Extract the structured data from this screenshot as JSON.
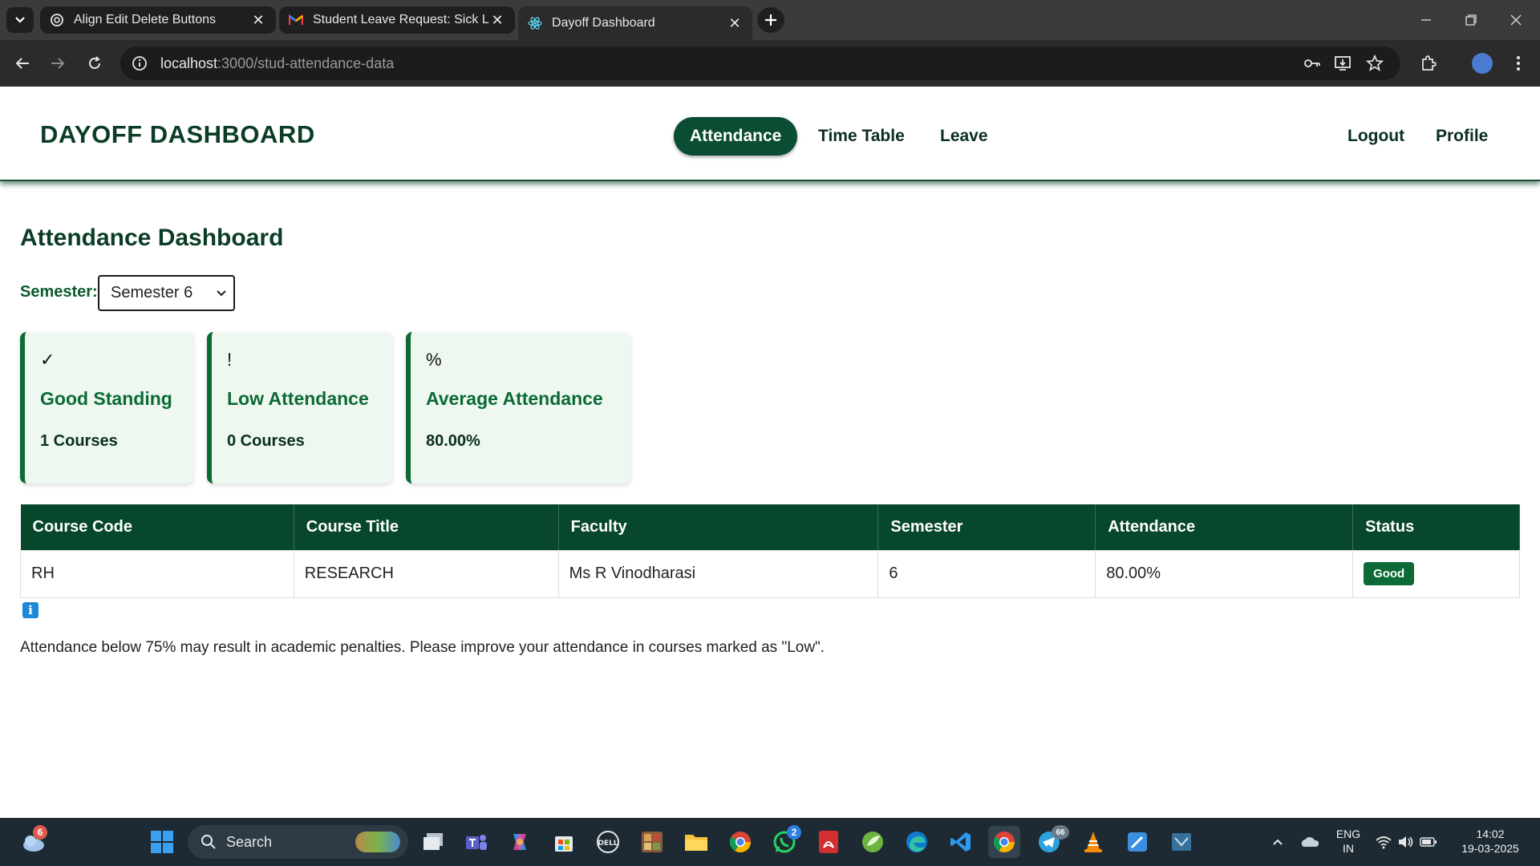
{
  "browser": {
    "tabs": [
      {
        "title": "Align Edit Delete Buttons",
        "icon": "openai-icon",
        "active": false
      },
      {
        "title": "Student Leave Request: Sick Lea",
        "icon": "gmail-icon",
        "active": false
      },
      {
        "title": "Dayoff Dashboard",
        "icon": "react-icon",
        "active": true
      }
    ],
    "url_host": "localhost",
    "url_path": ":3000/stud-attendance-data"
  },
  "nav": {
    "brand": "DAYOFF DASHBOARD",
    "links": [
      "Attendance",
      "Time Table",
      "Leave"
    ],
    "active": "Attendance",
    "right_links": [
      "Logout",
      "Profile"
    ]
  },
  "page": {
    "title": "Attendance Dashboard",
    "semester_label": "Semester:",
    "semester_selected": "Semester 6",
    "cards": [
      {
        "icon": "✓",
        "title": "Good Standing",
        "value": "1 Courses"
      },
      {
        "icon": "!",
        "title": "Low Attendance",
        "value": "0 Courses"
      },
      {
        "icon": "%",
        "title": "Average Attendance",
        "value": "80.00%"
      }
    ],
    "table": {
      "headers": [
        "Course Code",
        "Course Title",
        "Faculty",
        "Semester",
        "Attendance",
        "Status"
      ],
      "rows": [
        {
          "code": "RH",
          "title": "RESEARCH",
          "faculty": "Ms R Vinodharasi",
          "semester": "6",
          "attendance": "80.00%",
          "status": "Good"
        }
      ]
    },
    "note": "Attendance below 75% may result in academic penalties. Please improve your attendance in courses marked as \"Low\"."
  },
  "taskbar": {
    "search_placeholder": "Search",
    "weather_badge": "6",
    "whatsapp_badge": "2",
    "telegram_badge": "66",
    "lang_top": "ENG",
    "lang_bottom": "IN",
    "time": "14:02",
    "date": "19-03-2025"
  },
  "colors": {
    "primary": "#07472c",
    "accent": "#0b6a35",
    "card_bg": "#eef8f1"
  }
}
